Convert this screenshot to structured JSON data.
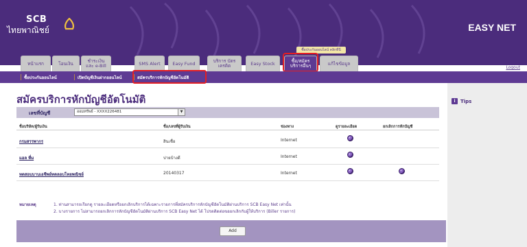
{
  "header": {
    "logo_text": "SCB",
    "logo_thai": "ไทยพาณิชย์",
    "brand": "EASY NET"
  },
  "nav": {
    "promo": "ซื้อประกันออนไลน์ คลิกที่นี่",
    "tabs": [
      {
        "label": "หน้าแรก"
      },
      {
        "label": "โอนเงิน"
      },
      {
        "label": "ชำระเงิน และ e-Bill"
      },
      {
        "label": "SMS Alert"
      },
      {
        "label": "Easy Fund"
      },
      {
        "label": "บริการ บัตรเครดิต"
      },
      {
        "label": "Easy Stock"
      },
      {
        "label": "ซื้อ/สมัคร บริการอื่นๆ"
      },
      {
        "label": "แก้ไขข้อมูล"
      }
    ],
    "logout": "Logout"
  },
  "subnav": {
    "items": [
      {
        "label": "ซื้อประกันออนไลน์"
      },
      {
        "label": "เปิดบัญชีเงินฝากออนไลน์"
      },
      {
        "label": "สมัครบริการหักบัญชีอัตโนมัติ"
      }
    ]
  },
  "main": {
    "title": "สมัครบริการหักบัญชีอัตโนมัติ",
    "account_label": "เลขที่บัญชี",
    "account_value": "ออมทรัพย์ - XXXX226481",
    "columns": [
      "ชื่อบริษัท/ผู้รับเงิน",
      "ชื่อ/เลขที่ผู้รับเงิน",
      "ช่องทาง",
      "ดูรายละเอียด",
      "ยกเลิกการหักบัญชี"
    ],
    "rows": [
      {
        "company": "กรมสรรพากร",
        "ref": "สินเชื่อ",
        "channel": "Internet",
        "view": true,
        "cancel": false
      },
      {
        "company": "แอล ที่ม",
        "ref": "บ่ายบ้างดี",
        "channel": "Internet",
        "view": true,
        "cancel": false
      },
      {
        "company": "ทดสอบบาบเอชีพย์ทดลอบโทยพณิชย์",
        "ref": "20140317",
        "channel": "Internet",
        "view": true,
        "cancel": true
      }
    ],
    "notes_label": "หมายเหตุ",
    "note1": "1.   ท่านสามารถเรียกดู รายละเอียดหรือยกเลิกบริการได้เฉพาะรายการที่สมัครบริการหักบัญชีอัตโนมัติผ่านบริการ SCB Easy Net เท่านั้น",
    "note2": "2.   บางรายการ ไม่สามารถยกเลิกการหักบัญชีอัตโนมัติผ่านบริการ SCB Easy Net ได้ โปรดติดต่อขอยกเลิกกับผู้ให้บริการ (Biller รายการ)",
    "add_button": "Add"
  },
  "sidebar": {
    "tips": "Tips"
  },
  "colors": {
    "brand_purple": "#4b2c7c",
    "tab_active": "#5e3a93",
    "highlight_red": "#e31e24"
  }
}
